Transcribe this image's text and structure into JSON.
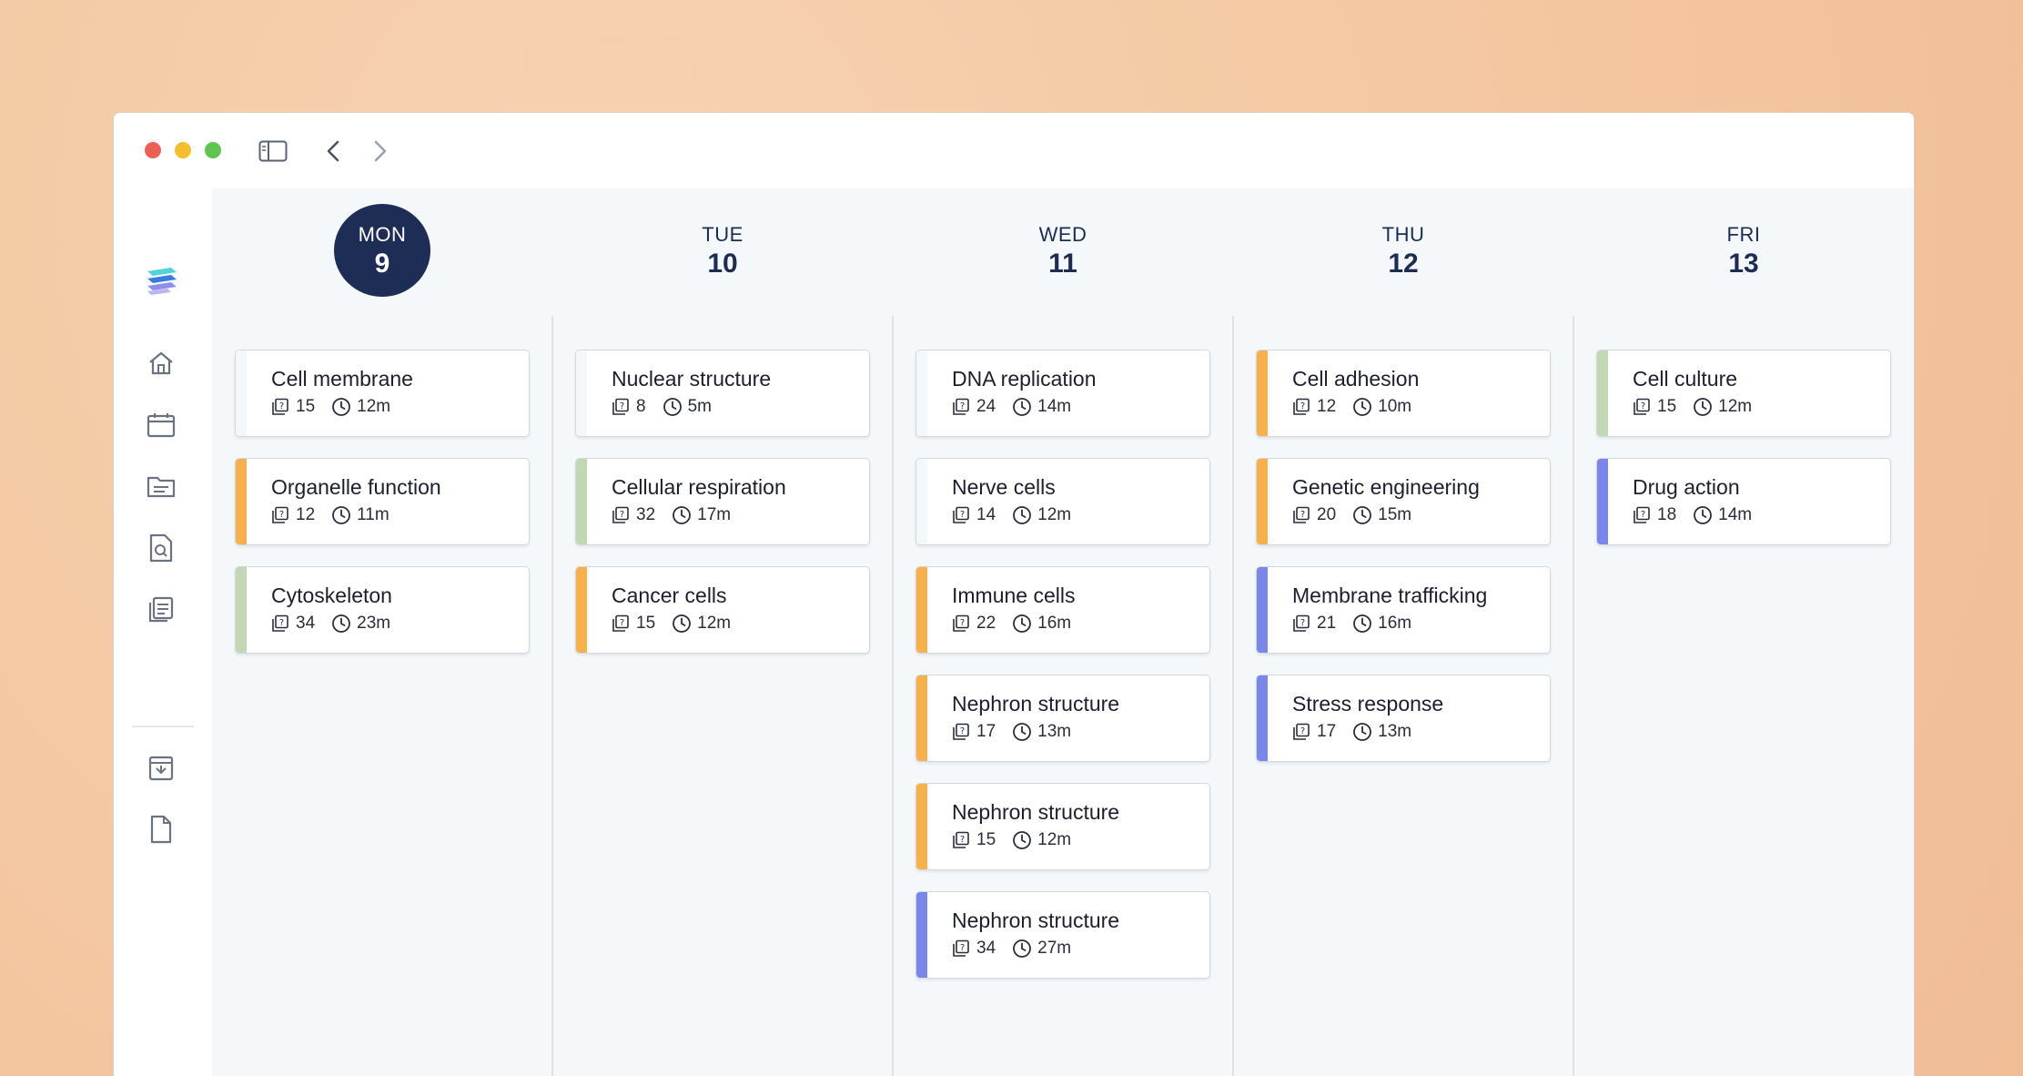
{
  "window": {
    "nav": {
      "back_icon": "chevron-left-icon",
      "forward_icon": "chevron-right-icon",
      "sidebar_icon": "sidebar-toggle-icon"
    }
  },
  "sidebar": {
    "items": [
      {
        "icon": "logo-icon"
      },
      {
        "icon": "home-icon"
      },
      {
        "icon": "calendar-icon"
      },
      {
        "icon": "folder-icon"
      },
      {
        "icon": "search-document-icon"
      },
      {
        "icon": "notes-icon"
      },
      {
        "icon": "archive-icon"
      },
      {
        "icon": "document-icon"
      }
    ]
  },
  "colors": {
    "orange": "#f7b04b",
    "green": "#c2d8b4",
    "purple": "#7a86e8",
    "none": "#f4f8fb",
    "active_day": "#1e2d55"
  },
  "days": [
    {
      "dow": "MON",
      "num": "9",
      "active": true,
      "cards": [
        {
          "title": "Cell membrane",
          "questions": "15",
          "time": "12m",
          "color": "none"
        },
        {
          "title": "Organelle function",
          "questions": "12",
          "time": "11m",
          "color": "orange"
        },
        {
          "title": "Cytoskeleton",
          "questions": "34",
          "time": "23m",
          "color": "green"
        }
      ]
    },
    {
      "dow": "TUE",
      "num": "10",
      "active": false,
      "cards": [
        {
          "title": "Nuclear structure",
          "questions": "8",
          "time": "5m",
          "color": "none"
        },
        {
          "title": "Cellular respiration",
          "questions": "32",
          "time": "17m",
          "color": "green"
        },
        {
          "title": "Cancer cells",
          "questions": "15",
          "time": "12m",
          "color": "orange"
        }
      ]
    },
    {
      "dow": "WED",
      "num": "11",
      "active": false,
      "cards": [
        {
          "title": "DNA replication",
          "questions": "24",
          "time": "14m",
          "color": "none"
        },
        {
          "title": "Nerve cells",
          "questions": "14",
          "time": "12m",
          "color": "none"
        },
        {
          "title": "Immune cells",
          "questions": "22",
          "time": "16m",
          "color": "orange"
        },
        {
          "title": "Nephron structure",
          "questions": "17",
          "time": "13m",
          "color": "orange"
        },
        {
          "title": "Nephron structure",
          "questions": "15",
          "time": "12m",
          "color": "orange"
        },
        {
          "title": "Nephron structure",
          "questions": "34",
          "time": "27m",
          "color": "purple"
        }
      ]
    },
    {
      "dow": "THU",
      "num": "12",
      "active": false,
      "cards": [
        {
          "title": "Cell adhesion",
          "questions": "12",
          "time": "10m",
          "color": "orange"
        },
        {
          "title": "Genetic engineering",
          "questions": "20",
          "time": "15m",
          "color": "orange"
        },
        {
          "title": "Membrane trafficking",
          "questions": "21",
          "time": "16m",
          "color": "purple"
        },
        {
          "title": "Stress response",
          "questions": "17",
          "time": "13m",
          "color": "purple"
        }
      ]
    },
    {
      "dow": "FRI",
      "num": "13",
      "active": false,
      "cards": [
        {
          "title": "Cell culture",
          "questions": "15",
          "time": "12m",
          "color": "green"
        },
        {
          "title": "Drug action",
          "questions": "18",
          "time": "14m",
          "color": "purple"
        }
      ]
    }
  ]
}
